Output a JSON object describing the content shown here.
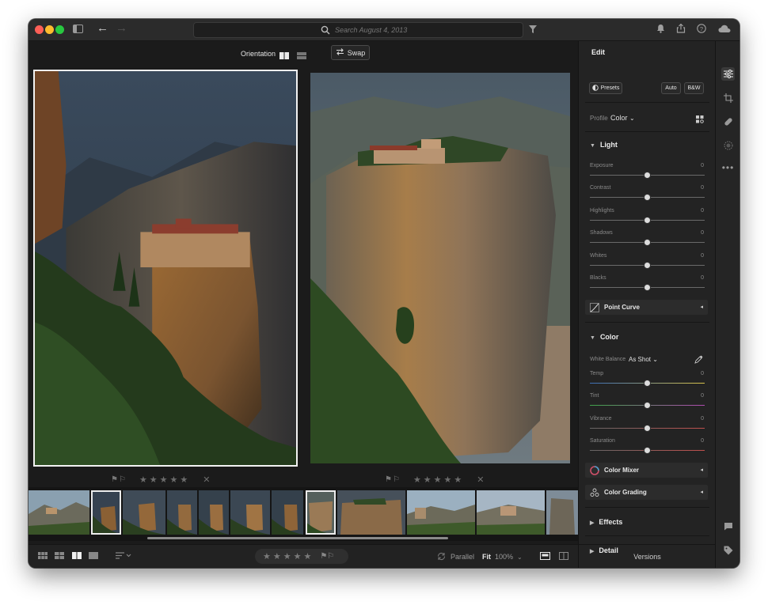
{
  "titlebar": {
    "search_placeholder": "Search August 4, 2013",
    "icons": [
      "sidebar-icon",
      "back-arrow-icon",
      "forward-arrow-icon",
      "filter-icon",
      "bell-icon",
      "share-icon",
      "help-icon",
      "cloud-icon"
    ]
  },
  "compare": {
    "orientation_label": "Orientation",
    "swap_label": "Swap"
  },
  "left_photo": {
    "stars": "★★★★★",
    "reject": "✕"
  },
  "right_photo": {
    "stars": "★★★★★",
    "reject": "✕"
  },
  "bottombar": {
    "stars": "★★★★★",
    "parallel_label": "Parallel",
    "fit_label": "Fit",
    "zoom_label": "100%"
  },
  "edit": {
    "title": "Edit",
    "presets_label": "Presets",
    "auto_label": "Auto",
    "bw_label": "B&W",
    "profile_label": "Profile",
    "profile_value": "Color",
    "light": {
      "title": "Light",
      "sliders": [
        {
          "label": "Exposure",
          "value": "0"
        },
        {
          "label": "Contrast",
          "value": "0"
        },
        {
          "label": "Highlights",
          "value": "0"
        },
        {
          "label": "Shadows",
          "value": "0"
        },
        {
          "label": "Whites",
          "value": "0"
        },
        {
          "label": "Blacks",
          "value": "0"
        }
      ]
    },
    "point_curve_label": "Point Curve",
    "color": {
      "title": "Color",
      "wb_label": "White Balance",
      "wb_value": "As Shot",
      "sliders": [
        {
          "label": "Temp",
          "value": "0"
        },
        {
          "label": "Tint",
          "value": "0"
        },
        {
          "label": "Vibrance",
          "value": "0"
        },
        {
          "label": "Saturation",
          "value": "0"
        }
      ]
    },
    "color_mixer_label": "Color Mixer",
    "color_grading_label": "Color Grading",
    "effects_label": "Effects",
    "detail_label": "Detail",
    "versions_label": "Versions"
  },
  "colors": {
    "window_bg": "#1b1b1b",
    "panel_bg": "#232323",
    "selection_border": "#f2f2f2"
  }
}
